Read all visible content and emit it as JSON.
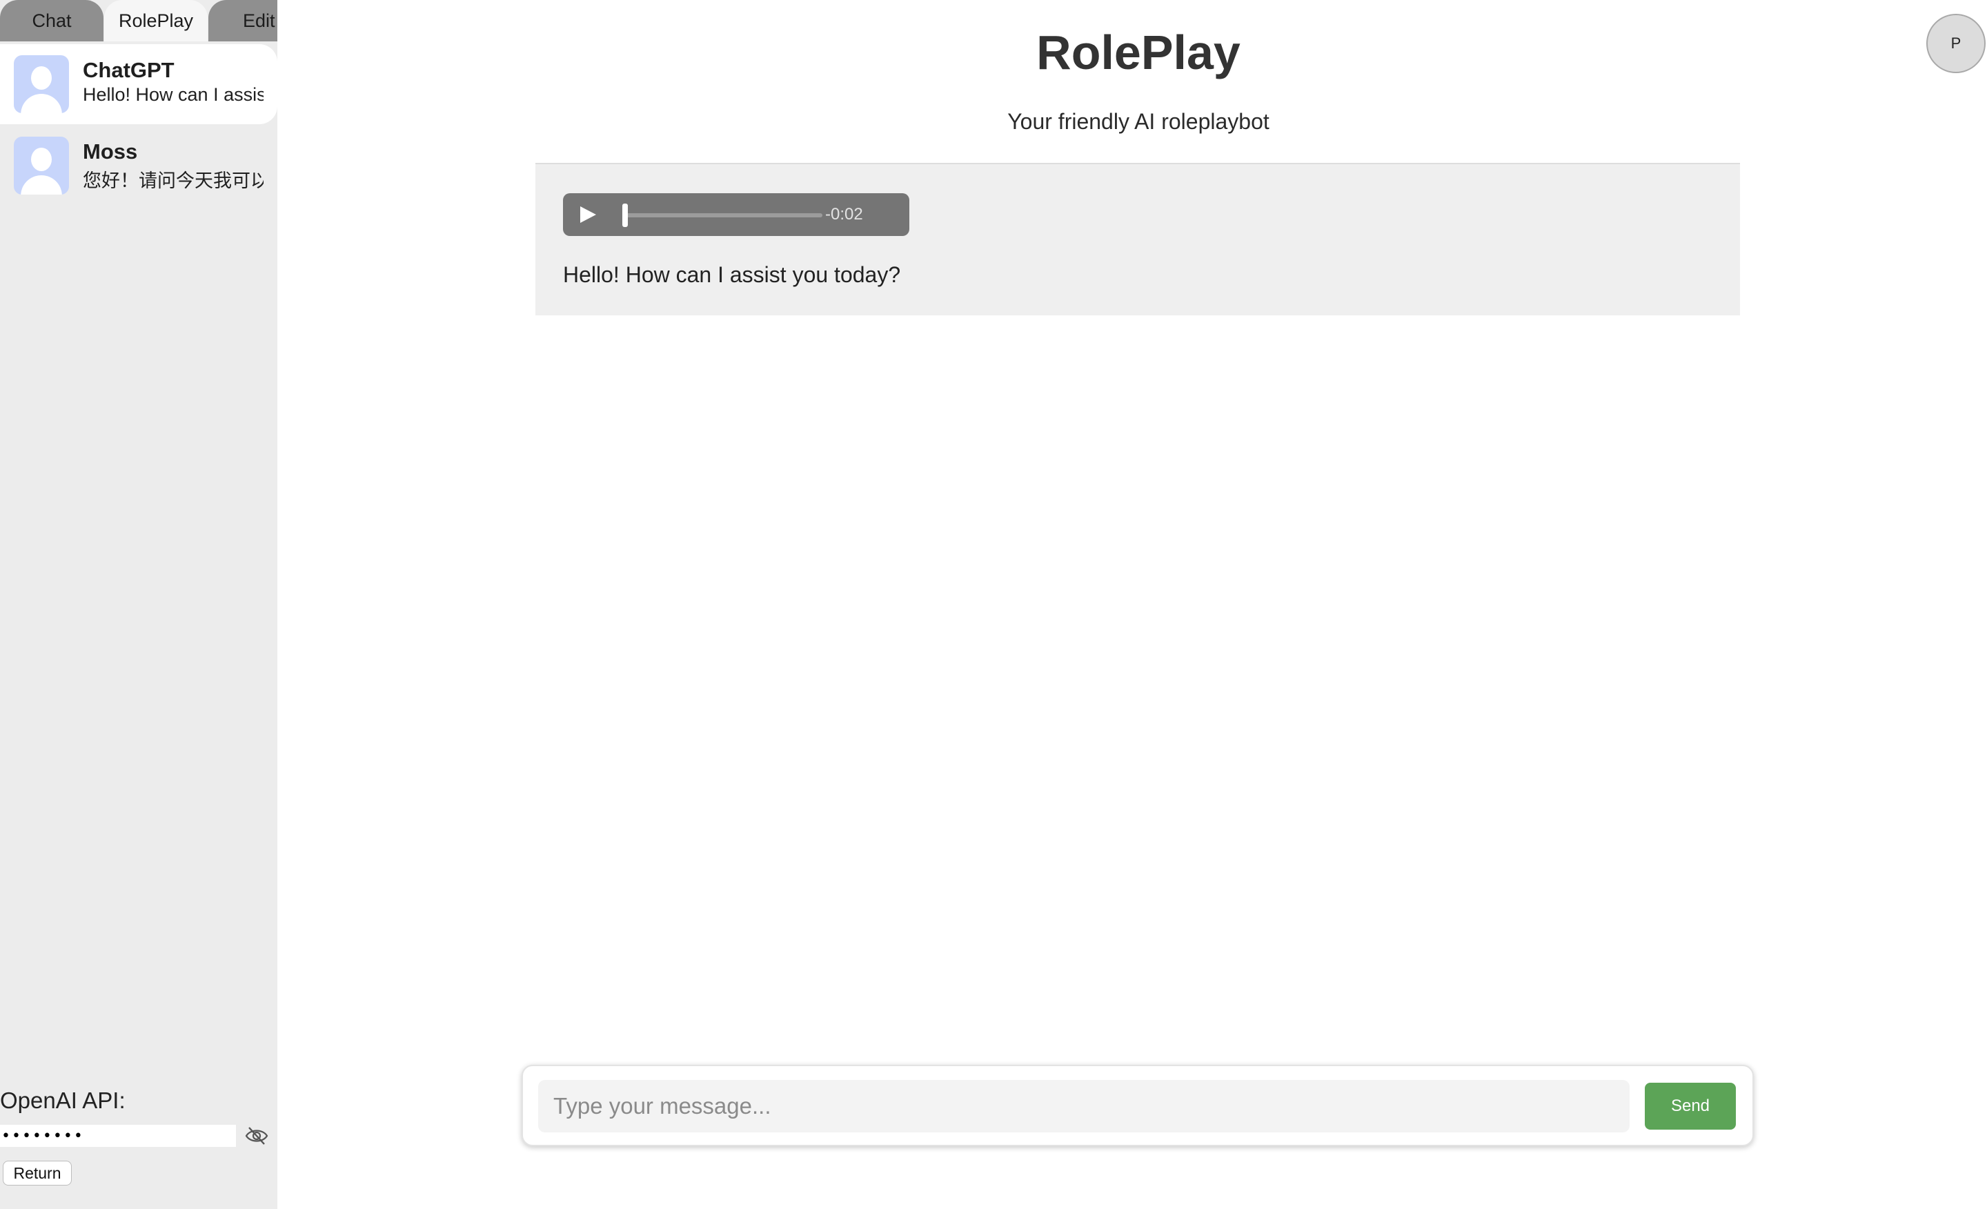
{
  "tabs": [
    "Chat",
    "RolePlay",
    "Edit"
  ],
  "sessions": [
    {
      "name": "ChatGPT",
      "last": "Hello! How can I assist you today?"
    },
    {
      "name": "Moss",
      "last": "您好！请问今天我可以帮您什么？"
    }
  ],
  "api": {
    "label": "OpenAI API:",
    "value": "••••••••",
    "return_label": "Return"
  },
  "header": {
    "title": "RolePlay",
    "subtitle": "Your friendly AI roleplaybot"
  },
  "profile": {
    "initial": "P"
  },
  "messages": [
    {
      "audio": {
        "time": "-0:02",
        "progress": 0.0
      },
      "text": "Hello! How can I assist you today?"
    }
  ],
  "composer": {
    "placeholder": "Type your message...",
    "send_label": "Send"
  },
  "colors": {
    "send_button": "#5ca457",
    "audio_player": "#757575",
    "sidebar": "#ececec"
  }
}
